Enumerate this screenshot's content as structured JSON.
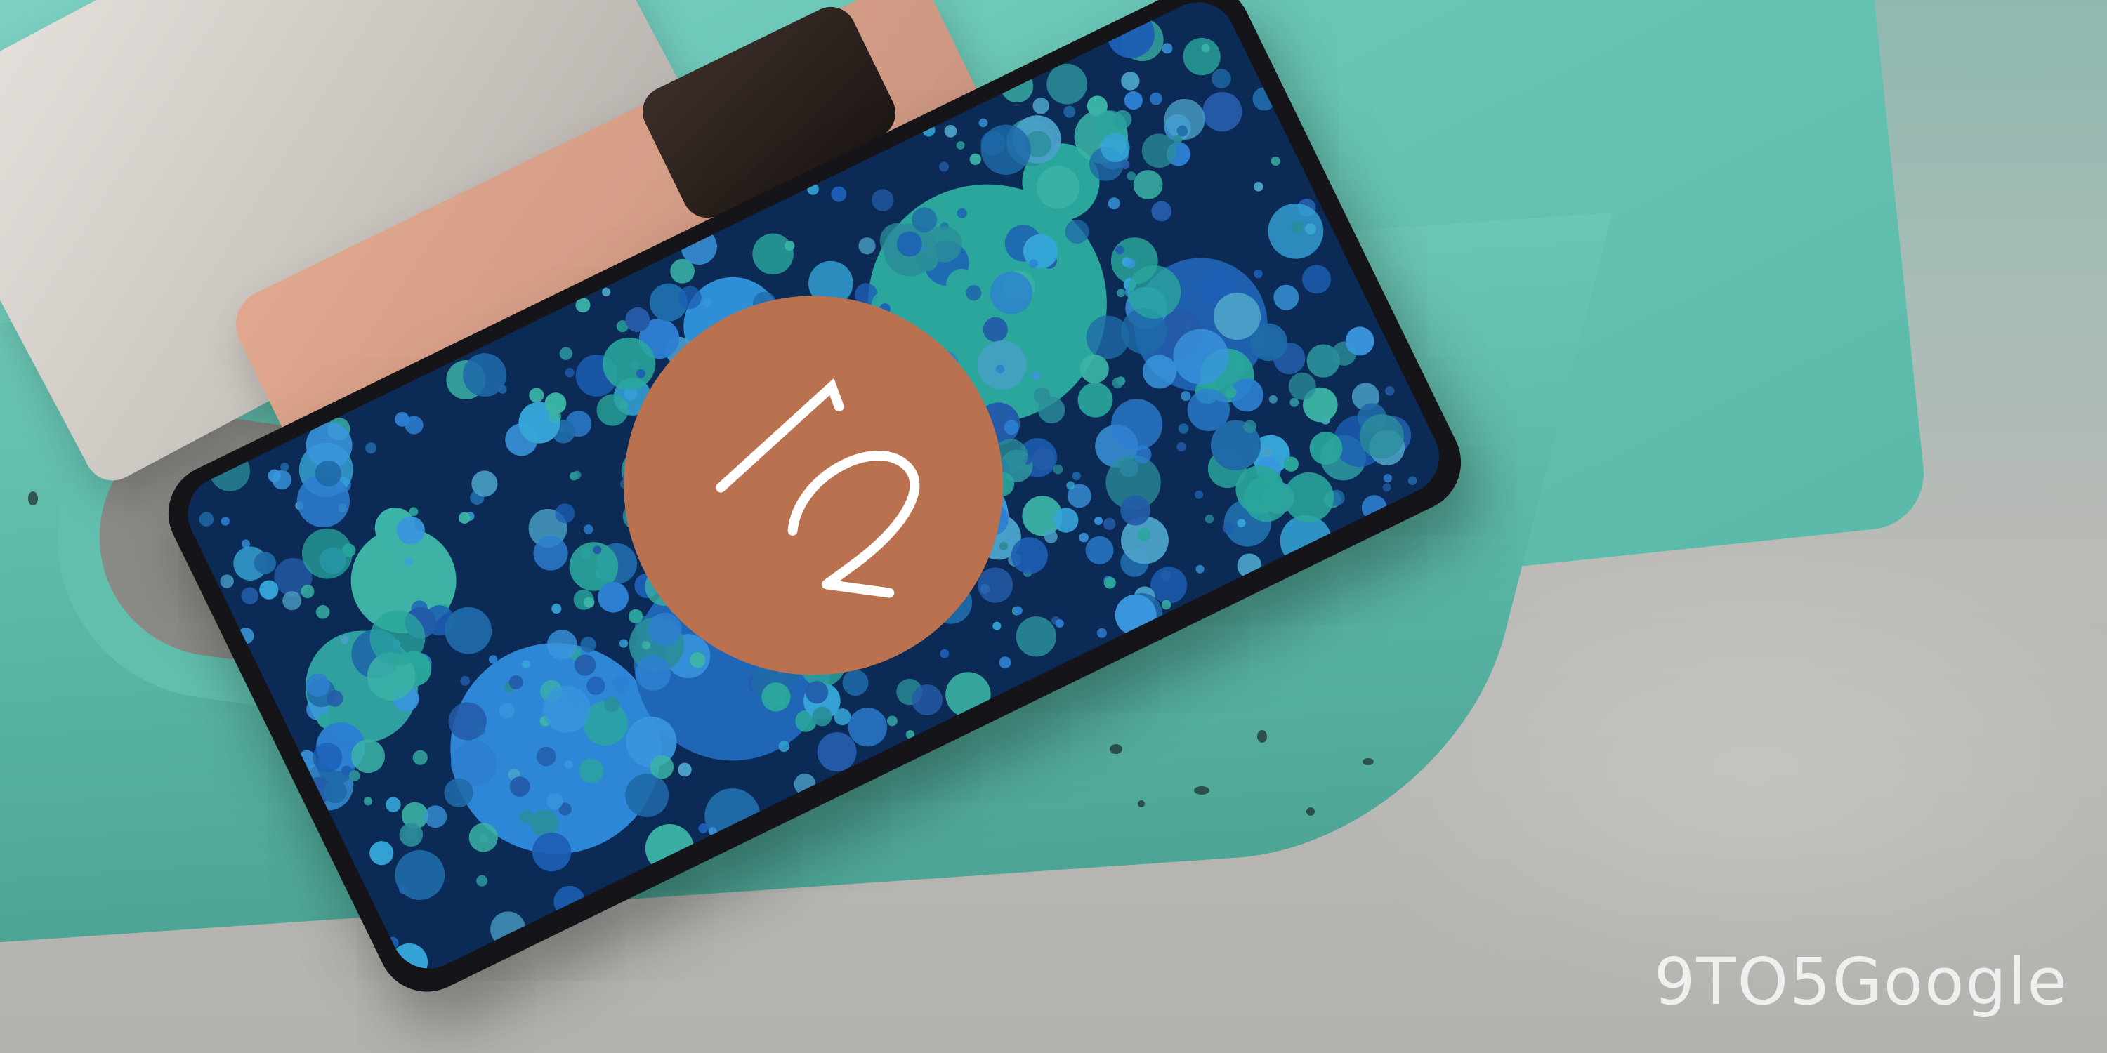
{
  "photo": {
    "subject": "smartphone-on-tray",
    "colors": {
      "tray": "#6cc8b8",
      "screen_bg": "#0b2a55",
      "badge": "#b9714f",
      "phone_body": "#151418",
      "bronze_phone": "#d19a84",
      "silver_phone": "#cfcac4"
    }
  },
  "badge": {
    "numeral": "12"
  },
  "watermark": {
    "text": "9TO5Google"
  }
}
